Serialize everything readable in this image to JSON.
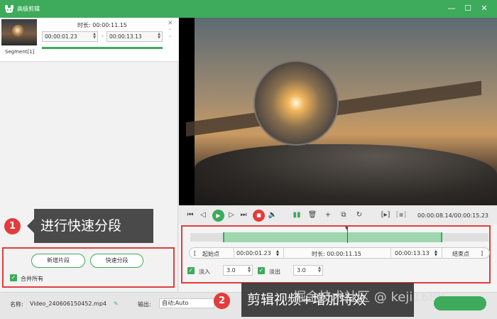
{
  "window": {
    "title": "高级剪辑"
  },
  "segment": {
    "label": "Segment[1]",
    "duration_label": "时长: 00:00:11.15",
    "start_time": "00:00:01.23",
    "end_time": "00:00:13.13",
    "separator": "-"
  },
  "left_actions": {
    "new_segment_label": "新增片段",
    "quick_split_label": "快速分段",
    "merge_all_label": "合并所有",
    "merge_all_checked": true
  },
  "callouts": {
    "one_number": "1",
    "one_text": "进行快速分段",
    "two_number": "2",
    "two_text": "剪辑视频+增加特效"
  },
  "watermark": "掘金技术社区 @ keji1688",
  "player": {
    "time_readout": "00:00:08.14/00:00:15.23"
  },
  "edit": {
    "start_label": "起始点",
    "start_value": "00:00:01.23",
    "duration_label": "时长: 00:00:11.15",
    "end_value": "00:00:13.13",
    "end_label": "结束点",
    "fade_in_label": "淡入",
    "fade_in_value": "3.0",
    "fade_in_checked": true,
    "fade_out_label": "淡出",
    "fade_out_value": "3.0",
    "fade_out_checked": true,
    "selection_start_fraction": 0.081,
    "selection_end_fraction": 0.861,
    "playhead_fraction": 0.531
  },
  "bottom": {
    "name_label": "名称:",
    "file_name": "Video_240606150452.mp4",
    "output_label": "输出:",
    "output_value": "自动;Auto"
  },
  "colors": {
    "accent_green": "#3dab5b",
    "highlight_red": "#e23c3c",
    "callout_gray": "#4a4a4a"
  }
}
